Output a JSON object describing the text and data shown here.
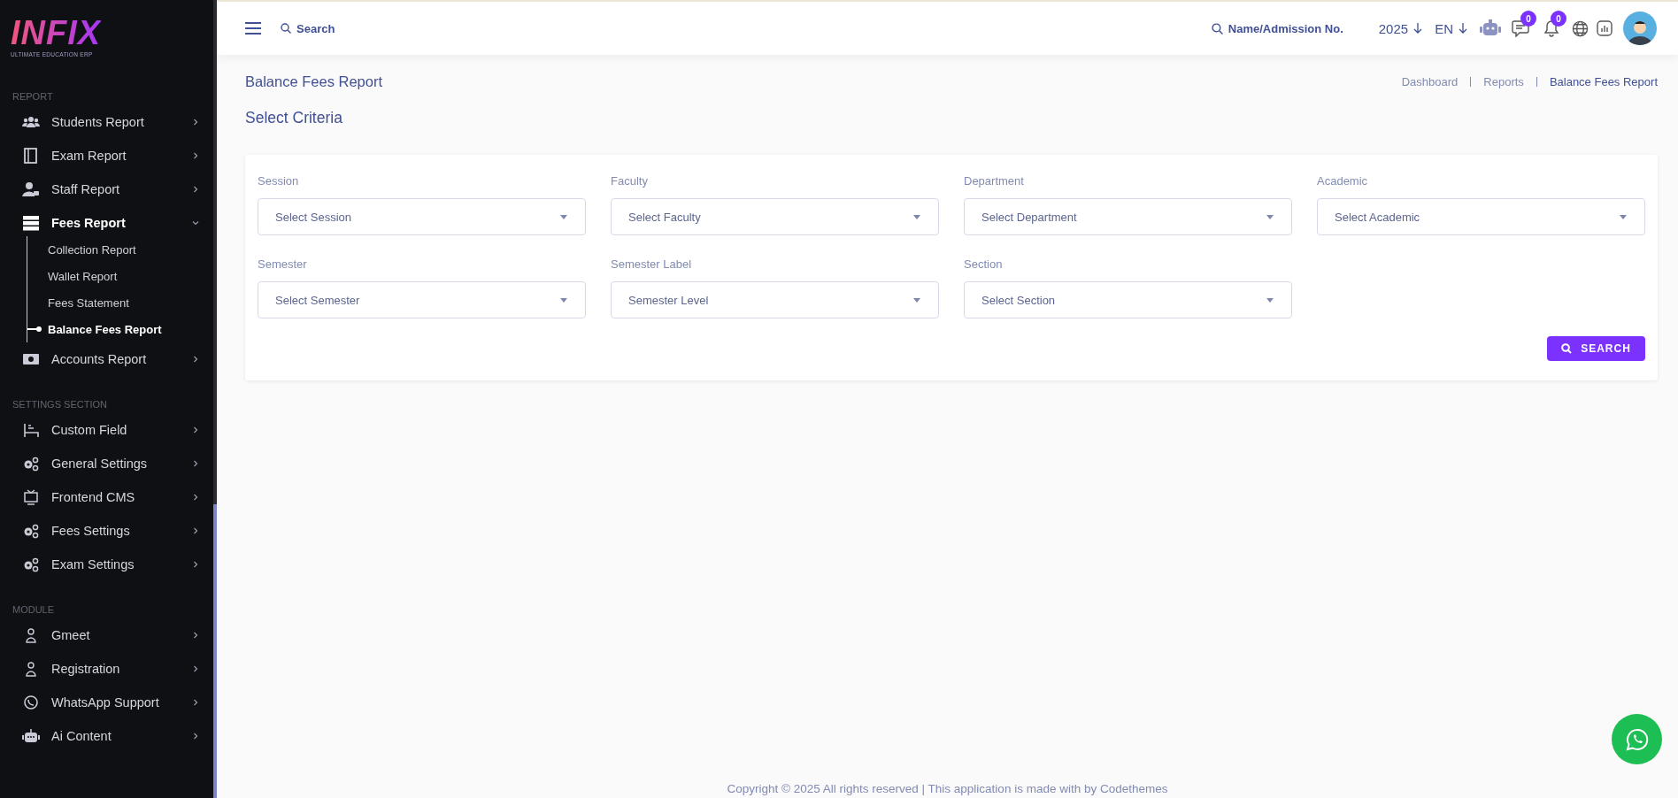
{
  "sidebar": {
    "logo": {
      "title": "INFIX",
      "tagline": "ULTIMATE EDUCATION ERP"
    },
    "sections": [
      {
        "heading": "REPORT",
        "items": [
          {
            "label": "Students Report",
            "expanded": false
          },
          {
            "label": "Exam Report",
            "expanded": false
          },
          {
            "label": "Staff Report",
            "expanded": false
          },
          {
            "label": "Fees Report",
            "expanded": true,
            "children": [
              {
                "label": "Collection Report",
                "selected": false
              },
              {
                "label": "Wallet Report",
                "selected": false
              },
              {
                "label": "Fees Statement",
                "selected": false
              },
              {
                "label": "Balance Fees Report",
                "selected": true
              }
            ]
          },
          {
            "label": "Accounts Report",
            "expanded": false
          }
        ]
      },
      {
        "heading": "SETTINGS SECTION",
        "items": [
          {
            "label": "Custom Field",
            "expanded": false
          },
          {
            "label": "General Settings",
            "expanded": false
          },
          {
            "label": "Frontend CMS",
            "expanded": false
          },
          {
            "label": "Fees Settings",
            "expanded": false
          },
          {
            "label": "Exam Settings",
            "expanded": false
          }
        ]
      },
      {
        "heading": "MODULE",
        "items": [
          {
            "label": "Gmeet",
            "expanded": false
          },
          {
            "label": "Registration",
            "expanded": false
          },
          {
            "label": "WhatsApp Support",
            "expanded": false
          },
          {
            "label": "Ai Content",
            "expanded": false
          }
        ]
      }
    ]
  },
  "header": {
    "search": {
      "placeholder": "Search"
    },
    "student_search": {
      "placeholder": "Name/Admission No."
    },
    "year": "2025",
    "language": "EN",
    "messages_badge": "0",
    "notifications_badge": "0"
  },
  "page": {
    "title": "Balance Fees Report",
    "breadcrumbs": [
      {
        "label": "Dashboard",
        "current": false
      },
      {
        "label": "Reports",
        "current": false
      },
      {
        "label": "Balance Fees Report",
        "current": true
      }
    ],
    "criteria_title": "Select Criteria",
    "fields": [
      {
        "label": "Session",
        "placeholder": "Select Session"
      },
      {
        "label": "Faculty",
        "placeholder": "Select Faculty"
      },
      {
        "label": "Department",
        "placeholder": "Select Department"
      },
      {
        "label": "Academic",
        "placeholder": "Select Academic"
      },
      {
        "label": "Semester",
        "placeholder": "Select Semester"
      },
      {
        "label": "Semester Label",
        "placeholder": "Semester Level"
      },
      {
        "label": "Section",
        "placeholder": "Select Section"
      }
    ],
    "search_button": "SEARCH"
  },
  "footer": "Copyright © 2025 All rights reserved | This application is made with by Codethemes"
}
